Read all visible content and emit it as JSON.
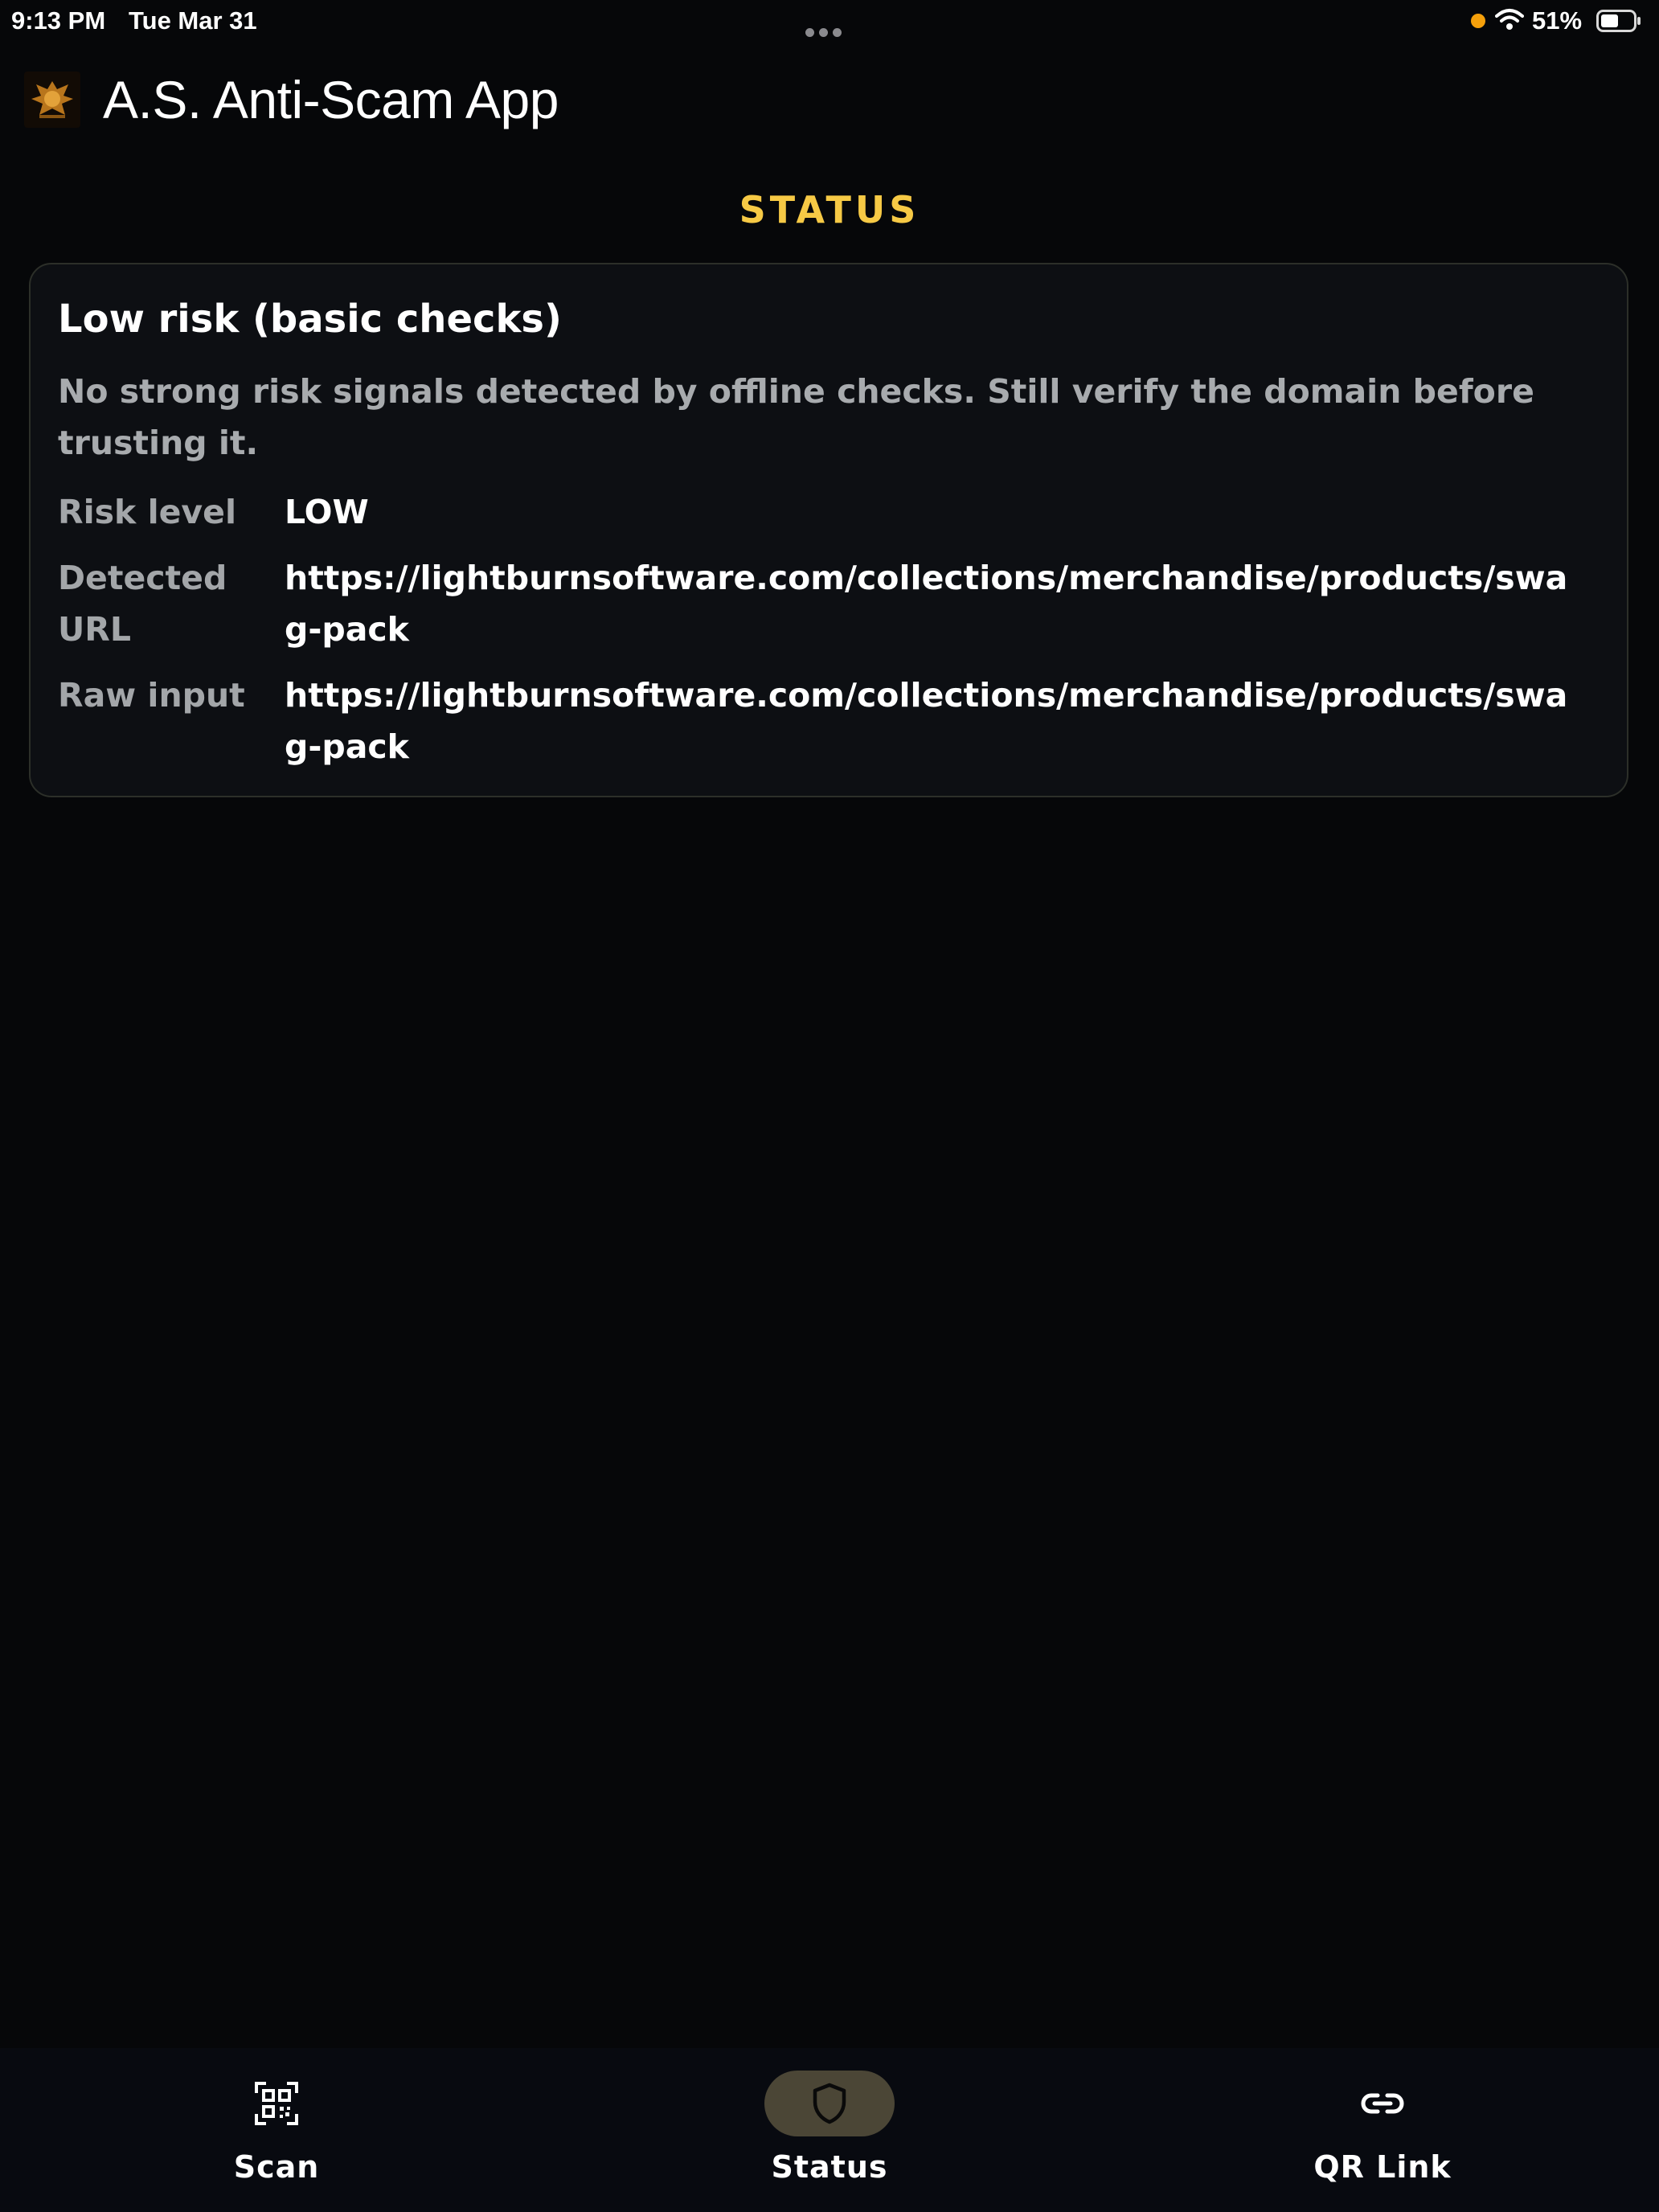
{
  "status_bar": {
    "time": "9:13 PM",
    "date": "Tue Mar 31",
    "battery_percent": "51%",
    "recording_indicator_color": "#f5a00b",
    "icons": [
      "more-dots-icon",
      "wifi-icon",
      "battery-icon"
    ]
  },
  "header": {
    "app_title": "A.S. Anti-Scam App",
    "logo_icon": "app-logo-icon"
  },
  "page": {
    "section_title": "STATUS",
    "accent_color": "#f6c945"
  },
  "result_card": {
    "title": "Low risk (basic checks)",
    "description": "No strong risk signals detected by offline checks. Still verify the domain before trusting it.",
    "rows": [
      {
        "label": "Risk level",
        "value": "LOW"
      },
      {
        "label": "Detected URL",
        "value": "https://lightburnsoftware.com/collections/merchandise/products/swag-pack"
      },
      {
        "label": "Raw input",
        "value": "https://lightburnsoftware.com/collections/merchandise/products/swag-pack"
      }
    ]
  },
  "tab_bar": {
    "tabs": [
      {
        "label": "Scan",
        "icon": "qr-scan-icon",
        "active": false
      },
      {
        "label": "Status",
        "icon": "shield-icon",
        "active": true
      },
      {
        "label": "QR Link",
        "icon": "link-icon",
        "active": false
      }
    ],
    "active_pill_color": "#4b4636"
  }
}
